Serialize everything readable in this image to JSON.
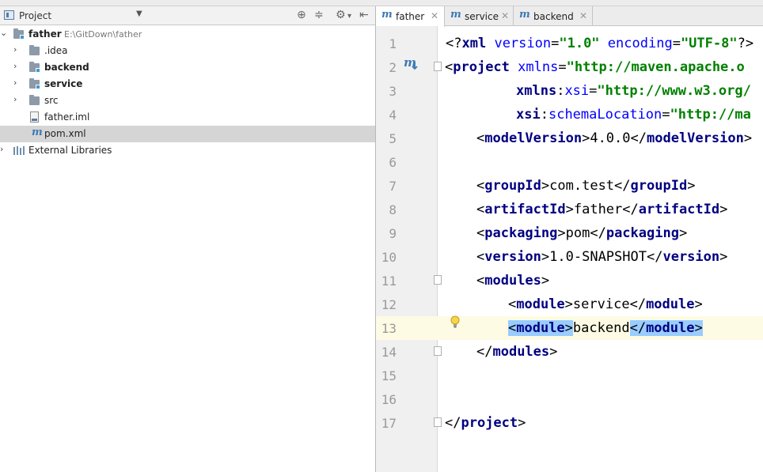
{
  "project_panel": {
    "title": "Project",
    "tree": [
      {
        "label": "father",
        "path": "E:\\GitDown\\father"
      },
      {
        "label": ".idea"
      },
      {
        "label": "backend"
      },
      {
        "label": "service"
      },
      {
        "label": "src"
      },
      {
        "label": "father.iml"
      },
      {
        "label": "pom.xml"
      },
      {
        "label": "External Libraries"
      }
    ]
  },
  "tabs": [
    {
      "label": "father"
    },
    {
      "label": "service"
    },
    {
      "label": "backend"
    }
  ],
  "editor": {
    "line_numbers": [
      "1",
      "2",
      "3",
      "4",
      "5",
      "6",
      "7",
      "8",
      "9",
      "10",
      "11",
      "12",
      "13",
      "14",
      "15",
      "16",
      "17"
    ],
    "current_line": "13",
    "code": {
      "l1": {
        "decl": "xml",
        "a1": "version",
        "v1": "\"1.0\"",
        "a2": "encoding",
        "v2": "\"UTF-8\""
      },
      "l2": {
        "tag": "project",
        "attr": "xmlns",
        "val": "\"http://maven.apache.o"
      },
      "l3": {
        "ns": "xmlns",
        "attr": "xsi",
        "val": "\"http://www.w3.org/"
      },
      "l4": {
        "ns": "xsi",
        "attr": "schemaLocation",
        "val": "\"http://ma"
      },
      "l5": {
        "tag": "modelVersion",
        "text": "4.0.0"
      },
      "l7": {
        "tag": "groupId",
        "text": "com.test"
      },
      "l8": {
        "tag": "artifactId",
        "text": "father"
      },
      "l9": {
        "tag": "packaging",
        "text": "pom"
      },
      "l10": {
        "tag": "version",
        "text": "1.0-SNAPSHOT"
      },
      "l11": {
        "tag": "modules"
      },
      "l12": {
        "tag": "module",
        "text": "service"
      },
      "l13": {
        "tag": "module",
        "text": "backend"
      },
      "l14": {
        "tag": "modules"
      },
      "l17": {
        "tag": "project"
      }
    }
  },
  "colors": {
    "tag": "#000080",
    "attribute": "#0000ff",
    "value": "#008000",
    "highlight": "#99ccff",
    "current_line": "#fdfbe3"
  }
}
